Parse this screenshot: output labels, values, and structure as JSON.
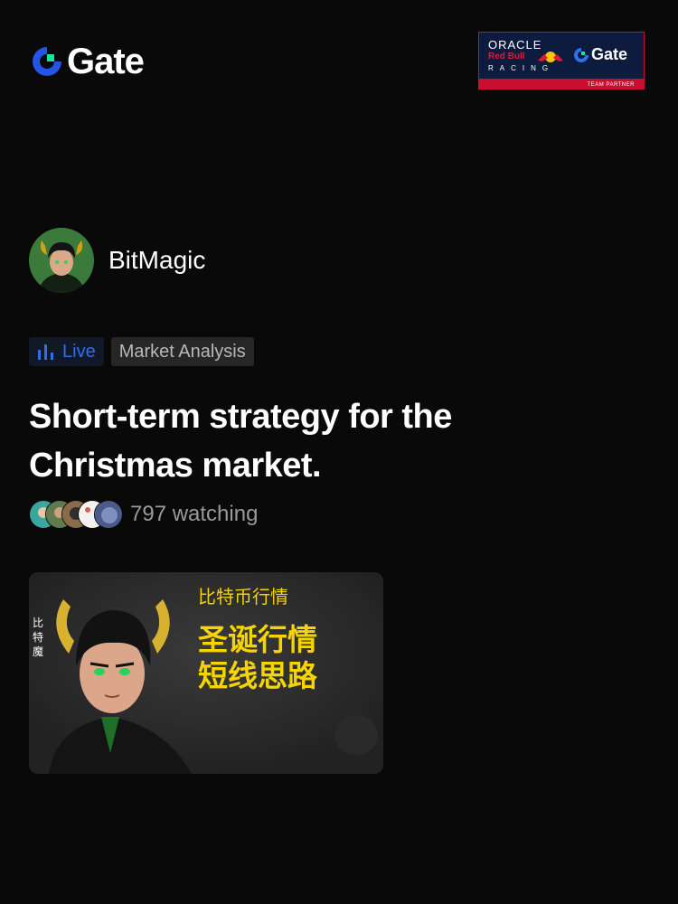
{
  "header": {
    "logo_text": "Gate",
    "logo_icon": "gate-logo-icon"
  },
  "partner_badge": {
    "line1": "ORACLE",
    "line2": "Red Bull",
    "line3": "RACING",
    "brand": "Gate",
    "strip": "TEAM PARTNER",
    "colors": {
      "navy": "#0d1b3f",
      "red": "#c8102e"
    }
  },
  "author": {
    "name": "BitMagic",
    "avatar": "avatar-image"
  },
  "tags": {
    "live_label": "Live",
    "live_icon": "bar-chart-icon",
    "category_label": "Market Analysis"
  },
  "post": {
    "title": "Short-term strategy for the Christmas market."
  },
  "watchers": {
    "count_text": "797 watching"
  },
  "cover": {
    "side_text": "比特魔",
    "subtitle": "比特币行情",
    "headline_line1": "圣诞行情",
    "headline_line2": "短线思路"
  },
  "colors": {
    "background": "#090909",
    "accent_blue": "#2f6fe8",
    "cover_text": "#f5d400"
  }
}
